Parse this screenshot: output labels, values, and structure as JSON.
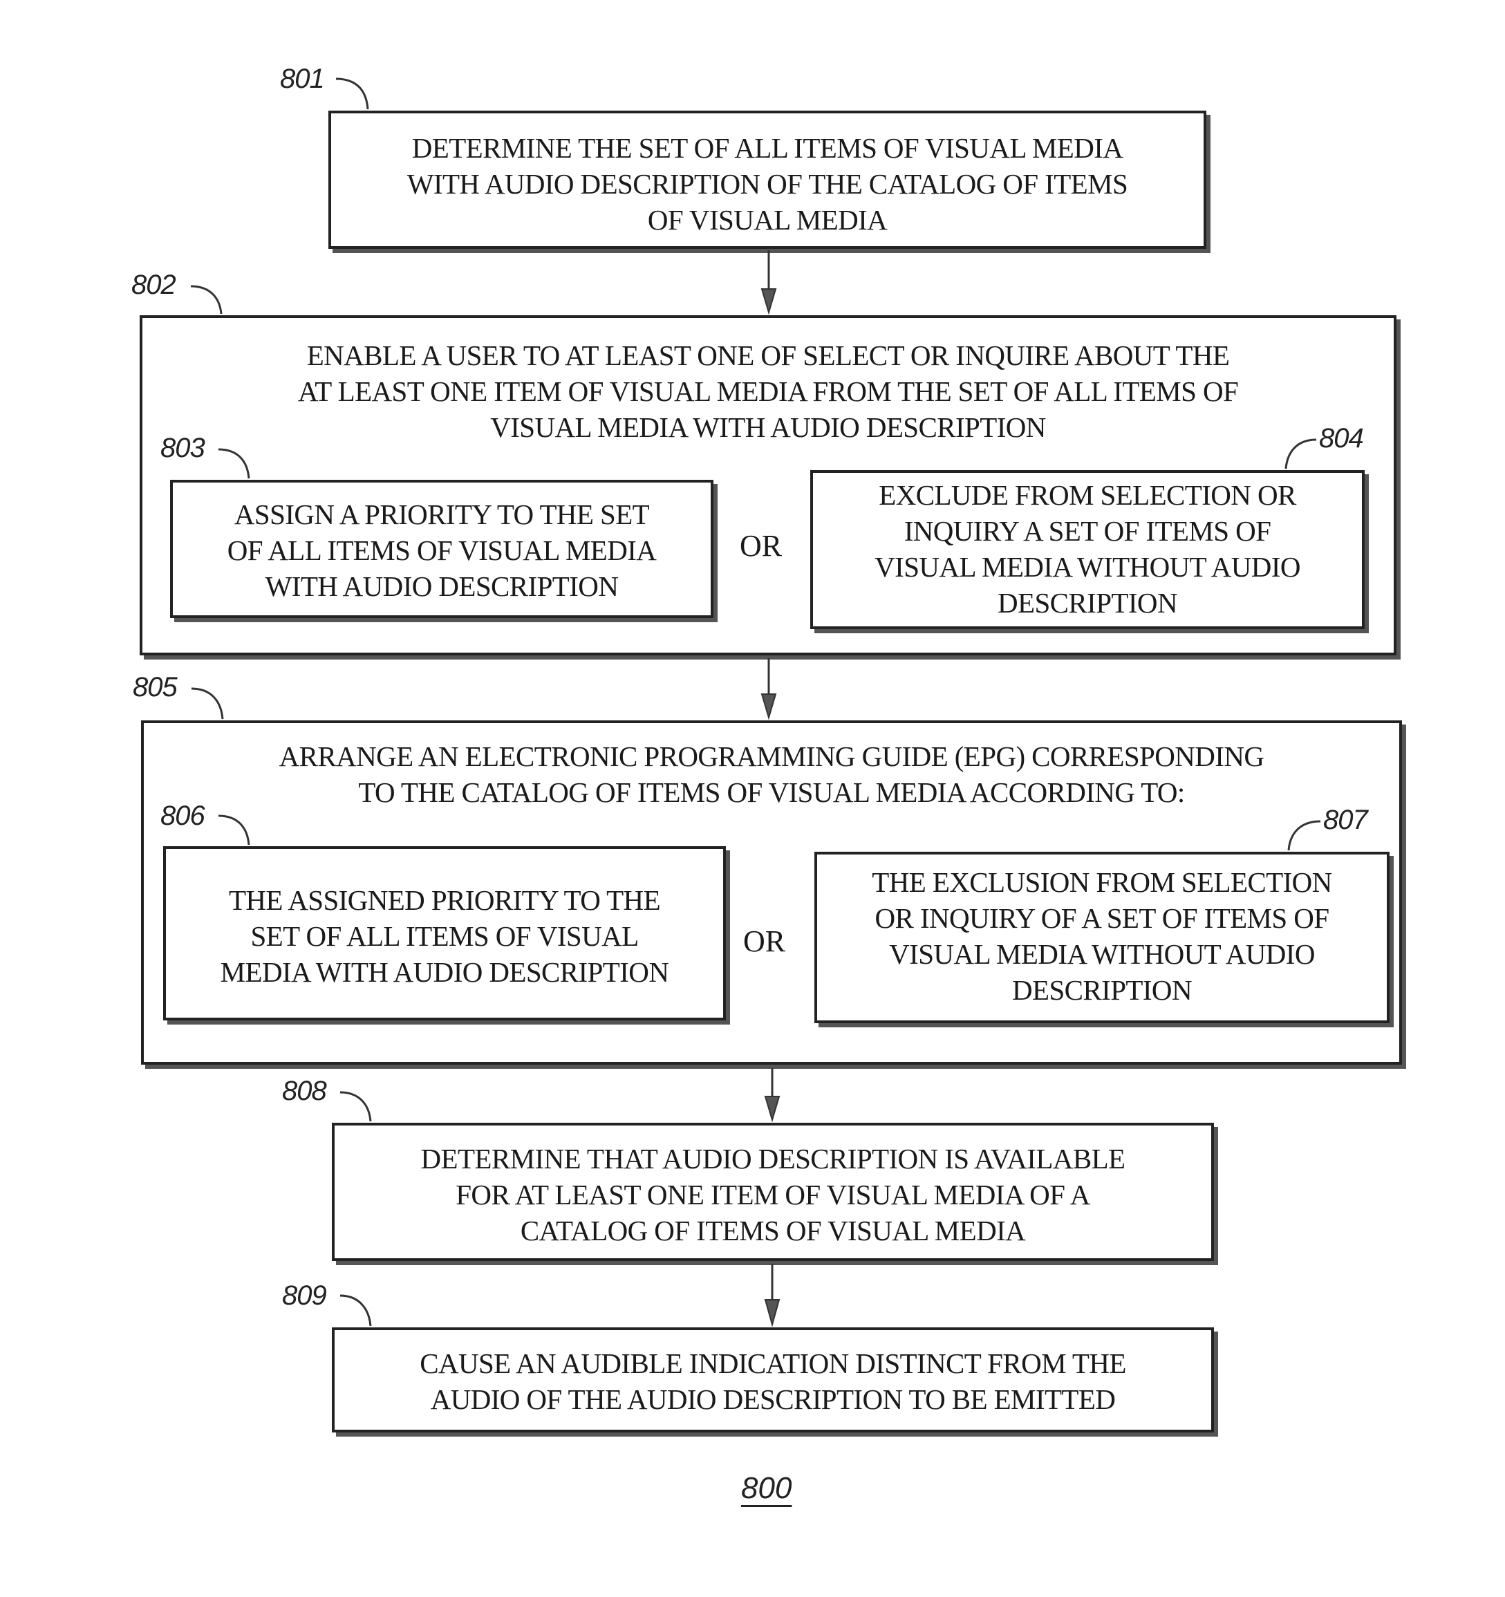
{
  "figure_number": "800",
  "steps": {
    "s801": {
      "ref": "801",
      "text": "DETERMINE THE SET OF ALL ITEMS OF VISUAL MEDIA\nWITH AUDIO DESCRIPTION OF THE CATALOG OF ITEMS\nOF VISUAL MEDIA"
    },
    "s802": {
      "ref": "802",
      "text": "ENABLE A USER TO AT LEAST ONE OF SELECT OR INQUIRE ABOUT THE\nAT LEAST ONE ITEM OF VISUAL MEDIA FROM THE SET OF ALL ITEMS OF\nVISUAL MEDIA WITH AUDIO DESCRIPTION"
    },
    "s803": {
      "ref": "803",
      "text": "ASSIGN A PRIORITY TO THE SET\nOF ALL ITEMS OF VISUAL MEDIA\nWITH AUDIO DESCRIPTION"
    },
    "s804": {
      "ref": "804",
      "text": "EXCLUDE FROM SELECTION OR\nINQUIRY A SET OF ITEMS OF\nVISUAL MEDIA WITHOUT AUDIO\nDESCRIPTION"
    },
    "s805": {
      "ref": "805",
      "text": "ARRANGE AN ELECTRONIC PROGRAMMING GUIDE (EPG) CORRESPONDING\nTO THE CATALOG OF ITEMS OF VISUAL MEDIA ACCORDING TO:"
    },
    "s806": {
      "ref": "806",
      "text": "THE ASSIGNED PRIORITY TO THE\nSET OF ALL ITEMS OF VISUAL\nMEDIA WITH AUDIO DESCRIPTION"
    },
    "s807": {
      "ref": "807",
      "text": "THE EXCLUSION FROM SELECTION\nOR INQUIRY OF A SET OF ITEMS OF\nVISUAL MEDIA WITHOUT AUDIO\nDESCRIPTION"
    },
    "s808": {
      "ref": "808",
      "text": "DETERMINE THAT AUDIO DESCRIPTION IS AVAILABLE\nFOR AT LEAST ONE ITEM OF VISUAL MEDIA OF A\nCATALOG OF ITEMS OF VISUAL MEDIA"
    },
    "s809": {
      "ref": "809",
      "text": "CAUSE AN AUDIBLE INDICATION DISTINCT FROM THE\nAUDIO OF THE AUDIO DESCRIPTION TO BE EMITTED"
    }
  },
  "connectors": {
    "or_1": "OR",
    "or_2": "OR"
  }
}
